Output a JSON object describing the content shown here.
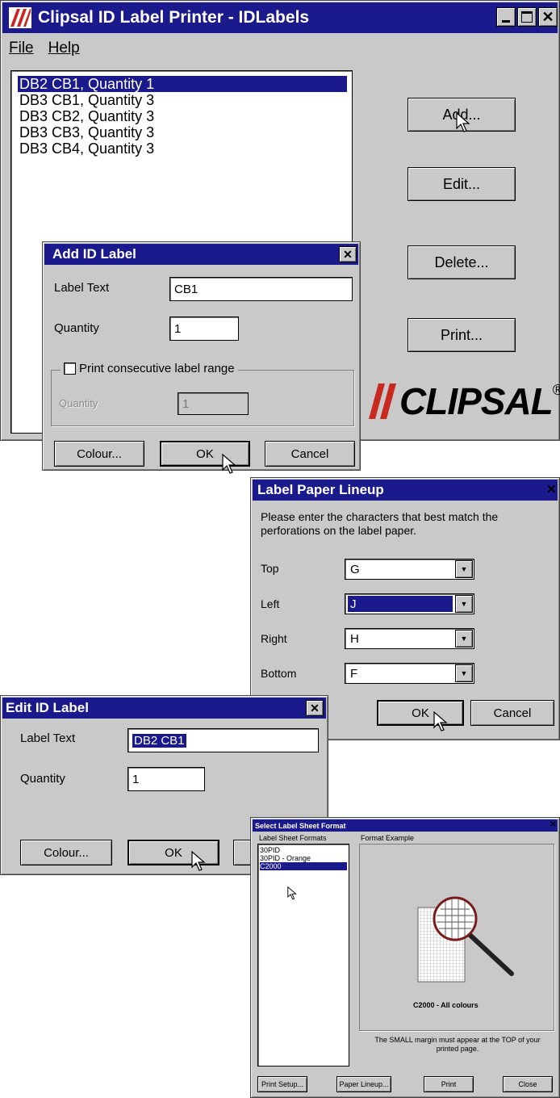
{
  "main_window": {
    "title": "Clipsal ID Label Printer - IDLabels",
    "menu": [
      "File",
      "Help"
    ],
    "labels": [
      "DB2 CB1, Quantity 1",
      "DB3 CB1, Quantity 3",
      "DB3 CB2, Quantity 3",
      "DB3 CB3, Quantity 3",
      "DB3 CB4, Quantity 3"
    ],
    "buttons": {
      "add": "Add...",
      "edit": "Edit...",
      "delete": "Delete...",
      "print": "Print..."
    },
    "logo_text": "CLIPSAL",
    "logo_mark": "®"
  },
  "add_dialog": {
    "title": "Add ID Label",
    "label_text_label": "Label Text",
    "label_text_value": "CB1",
    "quantity_label": "Quantity",
    "quantity_value": "1",
    "range_checkbox_label": "Print consecutive label range",
    "range_quantity_label": "Quantity",
    "range_quantity_value": "1",
    "buttons": {
      "colour": "Colour...",
      "ok": "OK",
      "cancel": "Cancel"
    }
  },
  "lineup_dialog": {
    "title": "Label Paper Lineup",
    "instructions": "Please enter the characters that best match the perforations on the label paper.",
    "fields": [
      {
        "label": "Top",
        "value": "G"
      },
      {
        "label": "Left",
        "value": "J"
      },
      {
        "label": "Right",
        "value": "H"
      },
      {
        "label": "Bottom",
        "value": "F"
      }
    ],
    "buttons": {
      "ok": "OK",
      "cancel": "Cancel"
    }
  },
  "edit_dialog": {
    "title": "Edit ID Label",
    "label_text_label": "Label Text",
    "label_text_value": "DB2 CB1",
    "quantity_label": "Quantity",
    "quantity_value": "1",
    "buttons": {
      "colour": "Colour...",
      "ok": "OK"
    }
  },
  "format_dialog": {
    "title": "Select Label Sheet Format",
    "formats_label": "Label Sheet Formats",
    "formats": [
      "30PID",
      "30PID - Orange",
      "C2000"
    ],
    "example_label": "Format Example",
    "example_caption": "C2000 - All colours",
    "note": "The SMALL margin must appear at the TOP of your printed page.",
    "buttons": {
      "print_setup": "Print Setup...",
      "paper_lineup": "Paper Lineup...",
      "print": "Print",
      "close": "Close"
    }
  },
  "colors": {
    "titlebar": "#1a1a8c",
    "window": "#c9c9c9",
    "accent_red": "#c8281e"
  }
}
